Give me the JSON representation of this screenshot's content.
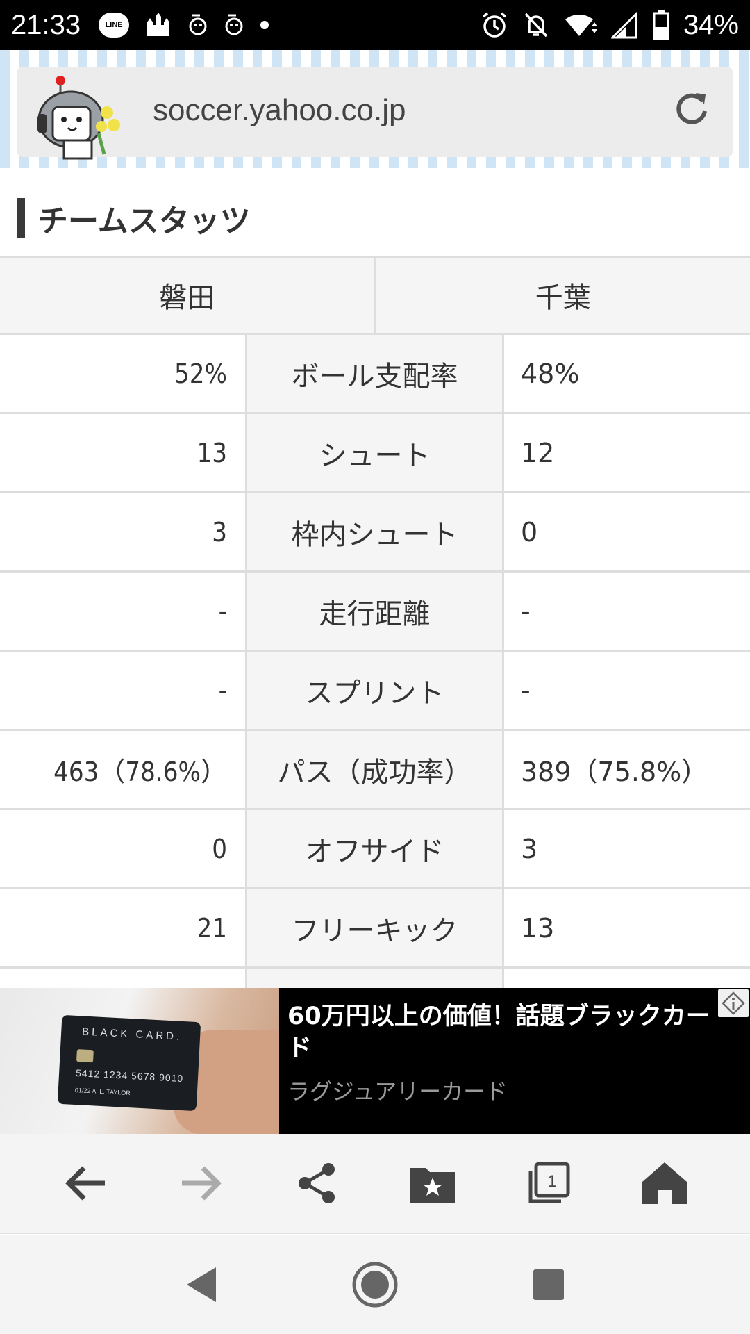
{
  "status_bar": {
    "time": "21:33",
    "line_icon_label": "LINE",
    "battery_percent": "34%",
    "icons": [
      "line-icon",
      "castle-icon",
      "notification-icon",
      "notification-icon",
      "dot-icon",
      "alarm-icon",
      "mute-icon",
      "wifi-icon",
      "signal-icon",
      "battery-icon"
    ]
  },
  "browser": {
    "url": "soccer.yahoo.co.jp"
  },
  "section": {
    "title": "チームスタッツ"
  },
  "stats": {
    "home_team": "磐田",
    "away_team": "千葉",
    "rows": [
      {
        "label": "ボール支配率",
        "home": "52%",
        "away": "48%"
      },
      {
        "label": "シュート",
        "home": "13",
        "away": "12"
      },
      {
        "label": "枠内シュート",
        "home": "3",
        "away": "0"
      },
      {
        "label": "走行距離",
        "home": "-",
        "away": "-"
      },
      {
        "label": "スプリント",
        "home": "-",
        "away": "-"
      },
      {
        "label": "パス（成功率）",
        "home": "463（78.6%）",
        "away": "389（75.8%）"
      },
      {
        "label": "オフサイド",
        "home": "0",
        "away": "3"
      },
      {
        "label": "フリーキック",
        "home": "21",
        "away": "13"
      }
    ]
  },
  "ad": {
    "title": "60万円以上の価値！話題ブラックカード",
    "subtitle": "ラグジュアリーカード",
    "card_title": "BLACK CARD.",
    "card_number": "5412 1234 5678 9010",
    "card_expiry": "01/22",
    "card_name": "A. L. TAYLOR"
  },
  "toolbar": {
    "tab_count": "1"
  },
  "colors": {
    "status_bar_bg": "#000000",
    "table_border": "#dddddd",
    "label_bg": "#f5f5f5",
    "ad_bg": "#000000"
  }
}
